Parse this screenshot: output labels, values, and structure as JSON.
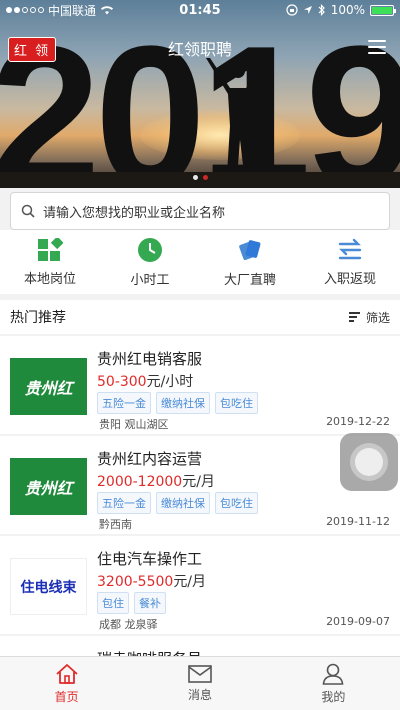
{
  "statusbar": {
    "carrier": "中国联通",
    "time": "01:45",
    "battery": "100%"
  },
  "header": {
    "badge": "红 领",
    "title": "红领职聘",
    "banner_year": "2019"
  },
  "search": {
    "placeholder": "请输入您想找的职业或企业名称"
  },
  "quicknav": [
    {
      "label": "本地岗位",
      "icon": "local-jobs-icon"
    },
    {
      "label": "小时工",
      "icon": "clock-icon"
    },
    {
      "label": "大厂直聘",
      "icon": "direct-hire-icon"
    },
    {
      "label": "入职返现",
      "icon": "cashback-icon"
    }
  ],
  "section": {
    "title": "热门推荐",
    "filter_label": "筛选"
  },
  "jobs": [
    {
      "title": "贵州红电销客服",
      "salary": "50-300",
      "unit": "元/小时",
      "tags": [
        "五险一金",
        "缴纳社保",
        "包吃住"
      ],
      "location": "贵阳 观山湖区",
      "date": "2019-12-22",
      "logo_text": "贵州红"
    },
    {
      "title": "贵州红内容运营",
      "salary": "2000-12000",
      "unit": "元/月",
      "tags": [
        "五险一金",
        "缴纳社保",
        "包吃住"
      ],
      "location": "黔西南",
      "date": "2019-11-12",
      "logo_text": "贵州红"
    },
    {
      "title": "住电汽车操作工",
      "salary": "3200-5500",
      "unit": "元/月",
      "tags": [
        "包住",
        "餐补"
      ],
      "location": "成都 龙泉驿",
      "date": "2019-09-07",
      "logo_text": "住电线束"
    },
    {
      "title": "瑞幸咖啡服务员"
    }
  ],
  "tabbar": [
    {
      "label": "首页",
      "icon": "home-icon",
      "active": true
    },
    {
      "label": "消息",
      "icon": "message-icon",
      "active": false
    },
    {
      "label": "我的",
      "icon": "profile-icon",
      "active": false
    }
  ],
  "colors": {
    "brand_red": "#e02b2b",
    "tag_blue": "#4a8bd6",
    "logo_green": "#1f8a3b"
  }
}
